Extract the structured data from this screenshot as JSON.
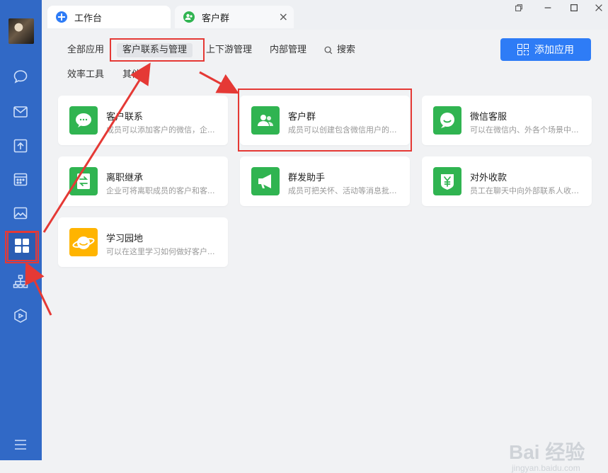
{
  "sidebar": {
    "items": [
      {
        "icon": "chat-icon"
      },
      {
        "icon": "mail-icon"
      },
      {
        "icon": "document-icon"
      },
      {
        "icon": "calendar-icon"
      },
      {
        "icon": "photo-icon"
      },
      {
        "icon": "workbench-grid-icon",
        "active": true
      },
      {
        "icon": "org-chart-icon"
      },
      {
        "icon": "cube-icon"
      },
      {
        "icon": "menu-icon"
      }
    ]
  },
  "tabs": [
    {
      "label": "工作台",
      "icon": "workbench-tab-icon",
      "color": "#2e7cf6"
    },
    {
      "label": "客户群",
      "icon": "customer-group-tab-icon",
      "color": "#30b451"
    }
  ],
  "window": {
    "close": "×"
  },
  "categories": [
    {
      "label": "全部应用"
    },
    {
      "label": "客户联系与管理",
      "active": true
    },
    {
      "label": "上下游管理"
    },
    {
      "label": "内部管理"
    },
    {
      "label": "搜索"
    },
    {
      "label": "效率工具"
    },
    {
      "label": "其他"
    }
  ],
  "add_button": {
    "label": "添加应用"
  },
  "apps": [
    {
      "name": "客户联系",
      "desc": "成员可以添加客户的微信，企...",
      "color": "#30b451",
      "icon": "wechat-chat-icon"
    },
    {
      "name": "客户群",
      "desc": "成员可以创建包含微信用户的...",
      "color": "#30b451",
      "icon": "people-icon"
    },
    {
      "name": "微信客服",
      "desc": "可以在微信内、外各个场景中...",
      "color": "#30b451",
      "icon": "customer-service-icon"
    },
    {
      "name": "离职继承",
      "desc": "企业可将离职成员的客户和客...",
      "color": "#30b451",
      "icon": "transfer-icon"
    },
    {
      "name": "群发助手",
      "desc": "成员可把关怀、活动等消息批...",
      "color": "#30b451",
      "icon": "megaphone-icon"
    },
    {
      "name": "对外收款",
      "desc": "员工在聊天中向外部联系人收款...",
      "color": "#30b451",
      "icon": "yuan-icon"
    },
    {
      "name": "学习园地",
      "desc": "可以在这里学习如何做好客户...",
      "color": "#ffb400",
      "icon": "planet-icon"
    }
  ],
  "watermark": {
    "text": "Bai 经验",
    "sub": "jingyan.baidu.com"
  },
  "colors": {
    "sidebar": "#3169c6",
    "accent": "#2e7cf6",
    "annotation": "#e53935"
  }
}
